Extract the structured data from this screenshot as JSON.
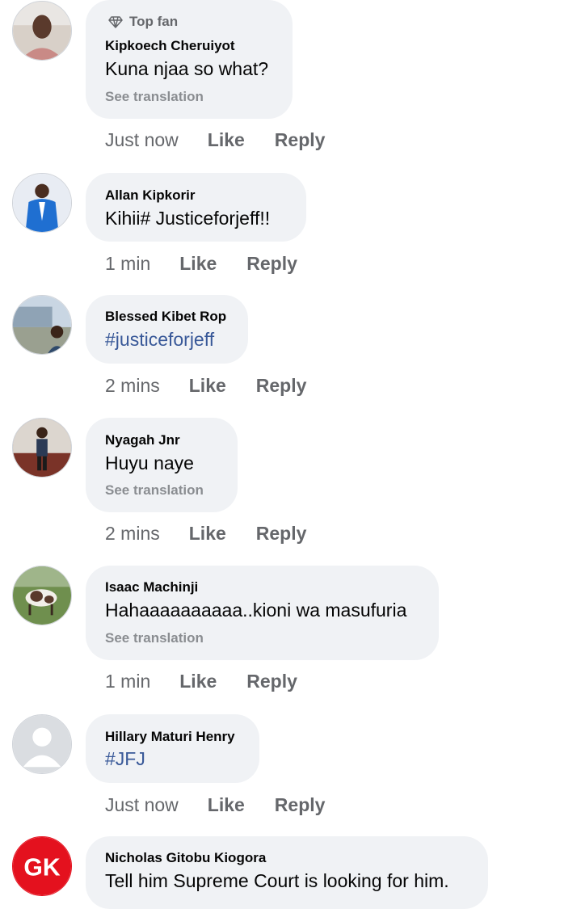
{
  "actions": {
    "like_label": "Like",
    "reply_label": "Reply",
    "translate_label": "See translation"
  },
  "comments": [
    {
      "badge": "Top fan",
      "name": "Kipkoech Cheruiyot",
      "text": "Kuna njaa so what?",
      "time": "Just now"
    },
    {
      "name": "Allan Kipkorir",
      "text": "Kihii# Justiceforjeff!!",
      "time": "1 min"
    },
    {
      "name": "Blessed Kibet Rop",
      "text": "#justiceforjeff",
      "time": "2 mins"
    },
    {
      "name": "Nyagah Jnr",
      "text": "Huyu naye",
      "time": "2 mins"
    },
    {
      "name": "Isaac Machinji",
      "text": "Hahaaaaaaaaaa..kioni wa masufuria",
      "time": "1 min"
    },
    {
      "name": "Hillary Maturi Henry",
      "text": "#JFJ",
      "time": "Just now"
    },
    {
      "name": "Nicholas Gitobu Kiogora",
      "text": "Tell him Supreme Court is looking for him.",
      "avatar_initials": "GK"
    }
  ],
  "colors": {
    "bubble": "#f0f2f5",
    "hashtag": "#385898",
    "meta": "#65676b",
    "gk_avatar": "#e4111e"
  }
}
